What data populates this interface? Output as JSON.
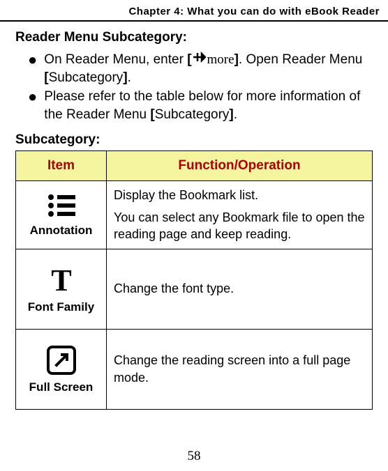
{
  "header": {
    "chapter": "Chapter 4: What you can do with eBook Reader"
  },
  "section": {
    "title": "Reader Menu Subcategory:",
    "bullets": [
      {
        "prefix": "On Reader Menu, enter ",
        "bracket_open": "[",
        "more_label": "more",
        "bracket_close": "]",
        "mid": ". Open Reader Menu ",
        "sub_open": "[",
        "sub_text": "Subcategory",
        "sub_close": "]",
        "suffix": "."
      },
      {
        "prefix": "Please refer to the table below for more information of the Reader Menu ",
        "sub_open": "[",
        "sub_text": "Subcategory",
        "sub_close": "]",
        "suffix": "."
      }
    ],
    "subcategory_label": "Subcategory:"
  },
  "table": {
    "headers": {
      "item": "Item",
      "function": "Function/Operation"
    },
    "rows": [
      {
        "label": "Annotation",
        "icon": "list-icon",
        "desc1": "Display the Bookmark list.",
        "desc2": "You can select any Bookmark file to open the reading page and keep reading."
      },
      {
        "label": "Font Family",
        "icon": "font-icon",
        "desc1": "Change the font type."
      },
      {
        "label": "Full Screen",
        "icon": "fullscreen-icon",
        "desc1": "Change the reading screen into a full page mode."
      }
    ]
  },
  "page_number": "58"
}
